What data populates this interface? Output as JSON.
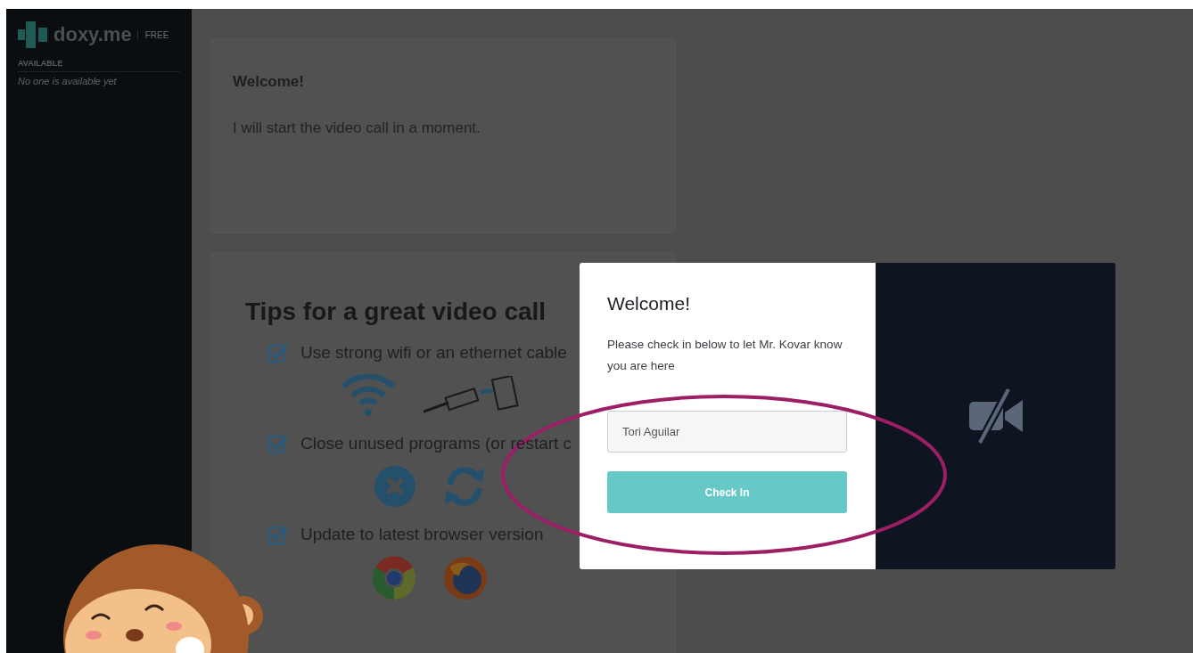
{
  "sidebar": {
    "logo_text": "doxy.me",
    "plan": "FREE",
    "section_label": "AVAILABLE",
    "empty_message": "No one is available yet"
  },
  "welcome_card": {
    "title": "Welcome!",
    "message": "I will start the video call in a moment."
  },
  "tips": {
    "title": "Tips for a great video call",
    "items": [
      {
        "text": "Use strong wifi or an ethernet cable",
        "checked": true
      },
      {
        "text": "Close unused programs (or restart c",
        "checked": true
      },
      {
        "text": "Update to latest browser version",
        "checked": true
      }
    ]
  },
  "checkin_modal": {
    "title": "Welcome!",
    "message": "Please check in below to let Mr. Kovar know you are here",
    "name_value": "Tori Aguilar",
    "button": "Check In"
  }
}
